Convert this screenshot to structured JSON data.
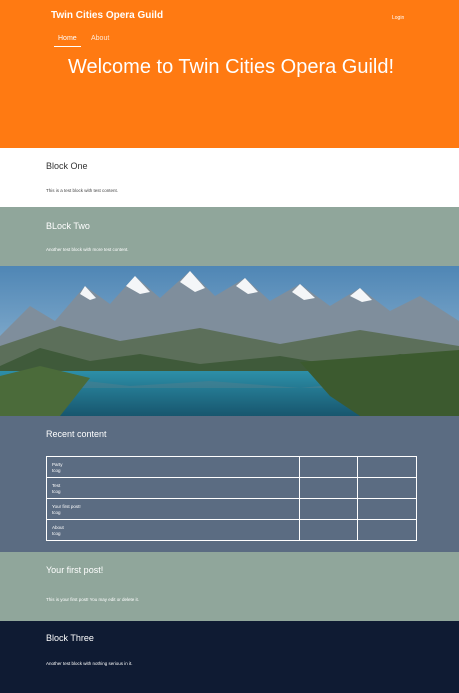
{
  "header": {
    "site_name": "Twin Cities Opera Guild",
    "login_label": "Login",
    "tabs": [
      {
        "label": "Home",
        "active": true
      },
      {
        "label": "About",
        "active": false
      }
    ],
    "hero_title": "Welcome to Twin Cities Opera Guild!",
    "accent_color": "#ff7a12"
  },
  "block_one": {
    "title": "Block One",
    "text": "This is a test block with test content."
  },
  "block_two": {
    "title": "BLock Two",
    "text": "Another test block with more test content."
  },
  "banner_image": {
    "description_icon": "mountain-lake-image"
  },
  "recent_content": {
    "title": "Recent content",
    "rows": [
      {
        "title": "Party",
        "author": "tcog"
      },
      {
        "title": "Test",
        "author": "tcog"
      },
      {
        "title": "Your first post!",
        "author": "tcog"
      },
      {
        "title": "About",
        "author": "tcog"
      }
    ]
  },
  "first_post": {
    "title": "Your first post!",
    "text": "This is your first post! You may edit or delete it."
  },
  "block_three": {
    "title": "Block Three",
    "text": "Another test block with nothing serious in it."
  },
  "colors": {
    "sage": "#90a69b",
    "slate": "#5b6c82",
    "navy": "#0f1b33"
  }
}
